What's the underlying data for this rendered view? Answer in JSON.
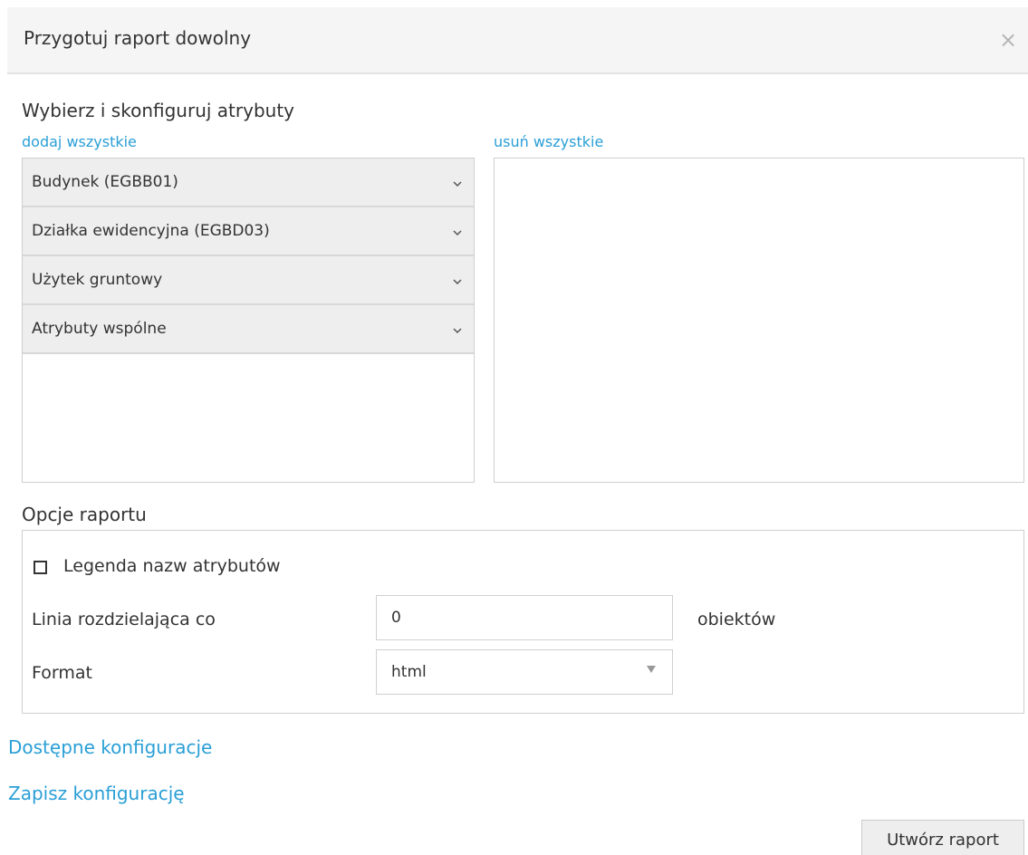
{
  "dialog": {
    "title": "Przygotuj raport dowolny",
    "close_glyph": "×"
  },
  "attributes": {
    "section_title": "Wybierz i skonfiguruj atrybuty",
    "add_all_label": "dodaj wszystkie",
    "remove_all_label": "usuń wszystkie",
    "items": [
      {
        "label": "Budynek (EGBB01)"
      },
      {
        "label": "Działka ewidencyjna (EGBD03)"
      },
      {
        "label": "Użytek gruntowy"
      },
      {
        "label": "Atrybuty wspólne"
      }
    ]
  },
  "options": {
    "section_title": "Opcje raportu",
    "legend_checkbox_label": "Legenda nazw atrybutów",
    "legend_checked": false,
    "separator_label": "Linia rozdzielająca co",
    "separator_value": "0",
    "separator_unit": "obiektów",
    "format_label": "Format",
    "format_value": "html"
  },
  "links": {
    "available_configs": "Dostępne konfiguracje",
    "save_config": "Zapisz konfigurację"
  },
  "actions": {
    "create_report": "Utwórz raport"
  },
  "colors": {
    "link": "#2a9fd6",
    "header_bg": "#f5f5f5",
    "item_bg": "#eeeeee"
  }
}
